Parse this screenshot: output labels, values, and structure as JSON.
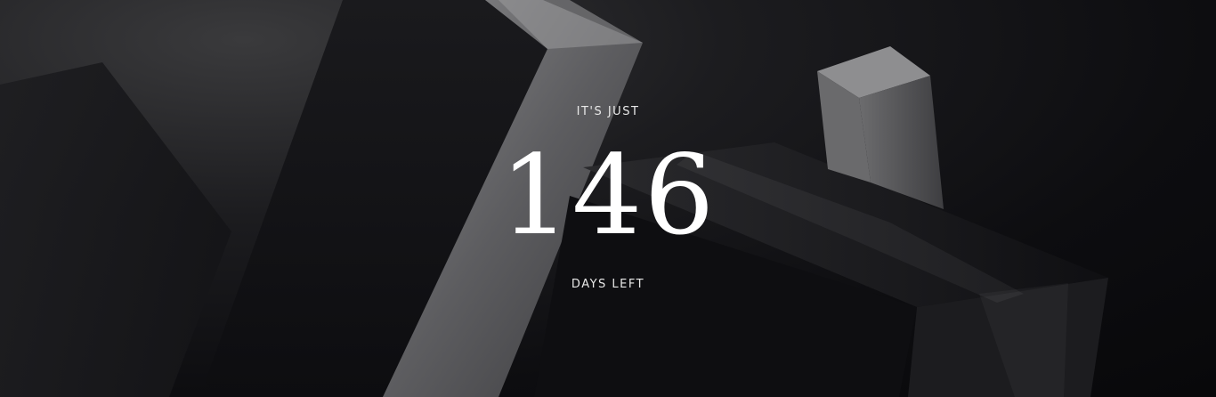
{
  "countdown": {
    "intro": "IT'S JUST",
    "value": "146",
    "caption": "DAYS LEFT"
  },
  "background": {
    "description_icon": "abstract-3d-blocks-image",
    "palette": {
      "base": "#0c0c0e",
      "highlight": "#6a6a6c",
      "text": "#ffffff"
    }
  }
}
